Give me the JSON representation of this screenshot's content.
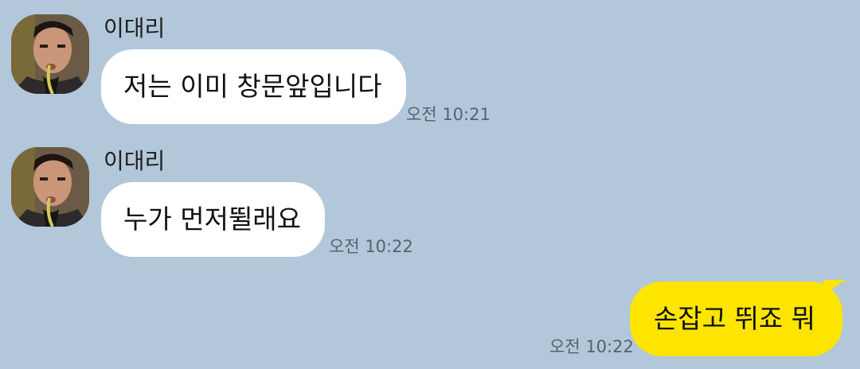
{
  "colors": {
    "background": "#b2c7da",
    "incoming_bubble": "#ffffff",
    "outgoing_bubble": "#fee500",
    "time_text": "#556270"
  },
  "messages": [
    {
      "direction": "incoming",
      "sender": "이대리",
      "avatar": "profile-photo",
      "text": "저는 이미 창문앞입니다",
      "time": "오전 10:21"
    },
    {
      "direction": "incoming",
      "sender": "이대리",
      "avatar": "profile-photo",
      "text": "누가 먼저뛸래요",
      "time": "오전 10:22"
    },
    {
      "direction": "outgoing",
      "text": "손잡고 뛰죠 뭐",
      "time": "오전 10:22"
    }
  ]
}
